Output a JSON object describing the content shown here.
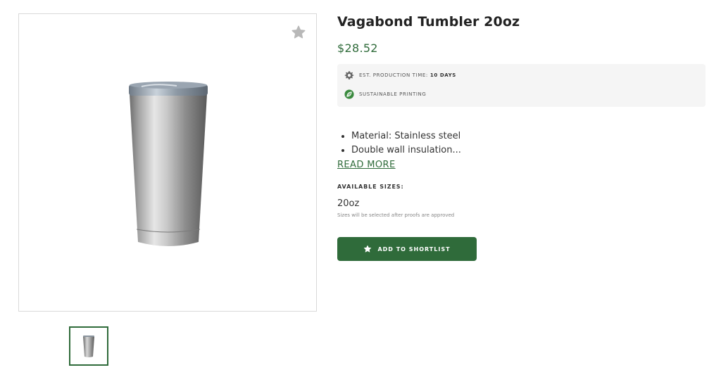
{
  "product": {
    "title": "Vagabond Tumbler 20oz",
    "price": "$28.52"
  },
  "info": {
    "production_label": "EST. PRODUCTION TIME:",
    "production_value": "10 DAYS",
    "sustainable_label": "SUSTAINABLE PRINTING"
  },
  "description": {
    "bullets": [
      "Material: Stainless steel",
      "Double wall insulation..."
    ],
    "read_more": "READ MORE"
  },
  "sizes": {
    "label": "AVAILABLE SIZES:",
    "value": "20oz",
    "note": "Sizes will be selected after proofs are approved"
  },
  "actions": {
    "shortlist_label": "ADD TO SHORTLIST"
  },
  "icons": {
    "favorite": "star-icon",
    "production": "gear-icon",
    "sustainable": "leaf-icon",
    "button": "star-icon"
  },
  "colors": {
    "accent": "#2f6b3a",
    "info_bg": "#f5f5f5",
    "star_gray": "#b8b8b8"
  }
}
